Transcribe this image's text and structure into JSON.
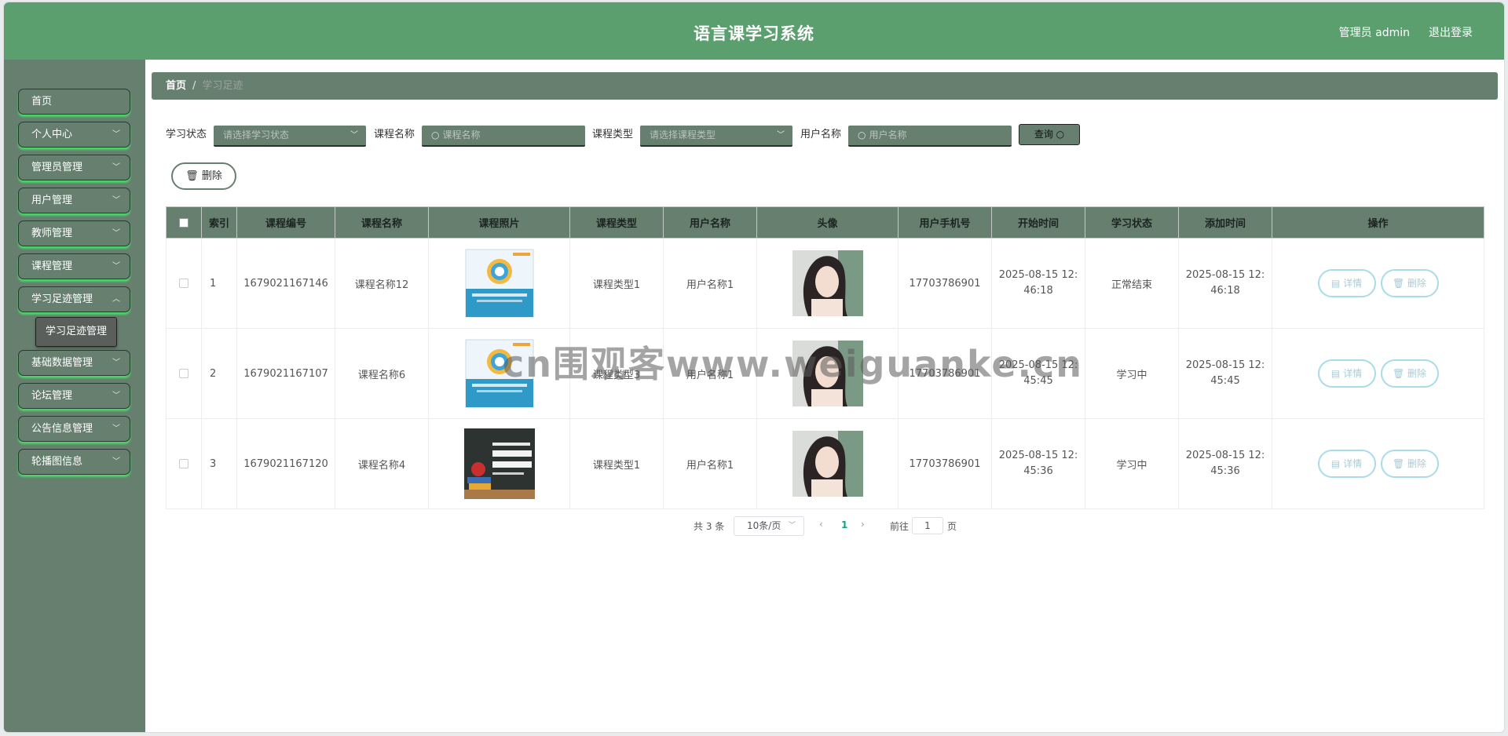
{
  "header": {
    "title": "语言课学习系统",
    "user": "管理员 admin",
    "logout": "退出登录"
  },
  "sidebar": {
    "items": [
      {
        "label": "首页",
        "has_arrow": false
      },
      {
        "label": "个人中心",
        "has_arrow": true
      },
      {
        "label": "管理员管理",
        "has_arrow": true
      },
      {
        "label": "用户管理",
        "has_arrow": true
      },
      {
        "label": "教师管理",
        "has_arrow": true
      },
      {
        "label": "课程管理",
        "has_arrow": true
      },
      {
        "label": "学习足迹管理",
        "has_arrow": true
      },
      {
        "label": "基础数据管理",
        "has_arrow": true
      },
      {
        "label": "论坛管理",
        "has_arrow": true
      },
      {
        "label": "公告信息管理",
        "has_arrow": true
      },
      {
        "label": "轮播图信息",
        "has_arrow": true
      }
    ],
    "submenu": "学习足迹管理"
  },
  "breadcrumb": {
    "home": "首页",
    "sep": "/",
    "current": "学习足迹"
  },
  "search": {
    "status_label": "学习状态",
    "status_placeholder": "请选择学习状态",
    "course_label": "课程名称",
    "course_placeholder": "课程名称",
    "type_label": "课程类型",
    "type_placeholder": "请选择课程类型",
    "user_label": "用户名称",
    "user_placeholder": "用户名称",
    "query": "查询"
  },
  "actions": {
    "delete": "删除"
  },
  "table": {
    "headers": [
      "索引",
      "课程编号",
      "课程名称",
      "课程照片",
      "课程类型",
      "用户名称",
      "头像",
      "用户手机号",
      "开始时间",
      "学习状态",
      "添加时间",
      "操作"
    ],
    "rows": [
      {
        "index": "1",
        "code": "1679021167146",
        "name": "课程名称12",
        "type": "课程类型1",
        "user": "用户名称1",
        "phone": "17703786901",
        "start": "2025-08-15 12:46:18",
        "status": "正常结束",
        "added": "2025-08-15 12:46:18"
      },
      {
        "index": "2",
        "code": "1679021167107",
        "name": "课程名称6",
        "type": "课程类型3",
        "user": "用户名称1",
        "phone": "17703786901",
        "start": "2025-08-15 12:45:45",
        "status": "学习中",
        "added": "2025-08-15 12:45:45"
      },
      {
        "index": "3",
        "code": "1679021167120",
        "name": "课程名称4",
        "type": "课程类型1",
        "user": "用户名称1",
        "phone": "17703786901",
        "start": "2025-08-15 12:45:36",
        "status": "学习中",
        "added": "2025-08-15 12:45:36"
      }
    ],
    "ops": {
      "detail": "详情",
      "delete": "删除"
    }
  },
  "pager": {
    "total": "共 3 条",
    "size": "10条/页",
    "current": "1",
    "goto": "前往",
    "goto_value": "1",
    "page": "页"
  },
  "watermark": "cn围观客www.weiguanke.cn",
  "colors": {
    "header": "#5b9f6f",
    "sidebar": "#667f6f",
    "accent": "#16a085"
  }
}
